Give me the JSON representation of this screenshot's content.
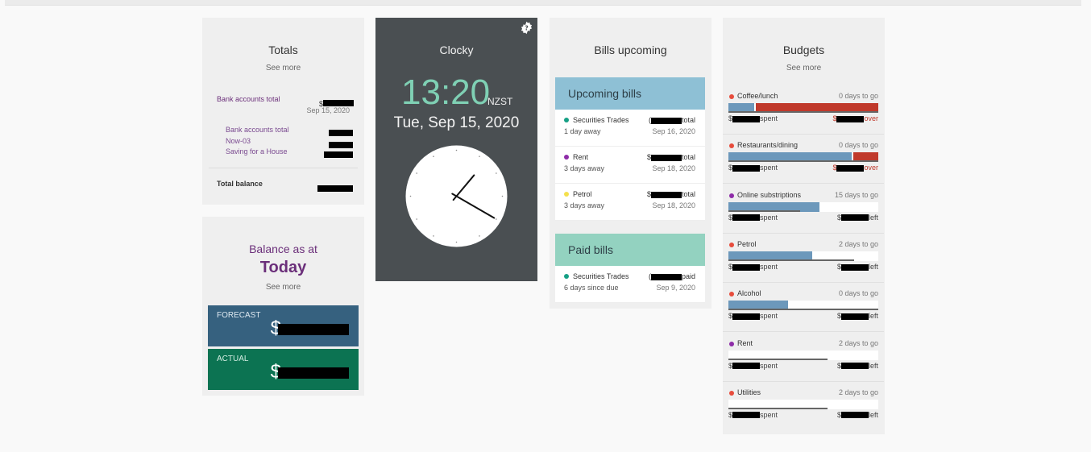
{
  "totals": {
    "title": "Totals",
    "see_more": "See more",
    "main_label": "Bank accounts total",
    "main_date": "Sep 15, 2020",
    "accounts": [
      {
        "label": "Bank accounts total"
      },
      {
        "label": "Now-03"
      },
      {
        "label": "Saving for a House"
      }
    ],
    "total_balance_label": "Total balance",
    "currency_prefix": "$"
  },
  "balance": {
    "label": "Balance as at",
    "period": "Today",
    "see_more": "See more",
    "forecast_label": "FORECAST",
    "actual_label": "ACTUAL",
    "currency_prefix": "$",
    "colors": {
      "forecast": "#36617f",
      "actual": "#0c7352"
    }
  },
  "clocky": {
    "title": "Clocky",
    "time": "13:20",
    "timezone": "NZST",
    "date": "Tue, Sep 15, 2020",
    "hour": 13,
    "minute": 20,
    "settings_icon": "gear-help-icon",
    "time_color": "#7fd0b4"
  },
  "bills": {
    "title": "Bills upcoming",
    "upcoming_heading": "Upcoming bills",
    "paid_heading": "Paid bills",
    "upcoming": [
      {
        "name": "Securities Trades",
        "due": "1 day away",
        "amount_prefix": "(",
        "amount_suffix": "total",
        "date": "Sep 16, 2020",
        "color": "#16a085"
      },
      {
        "name": "Rent",
        "due": "3 days away",
        "amount_prefix": "$",
        "amount_suffix": "total",
        "date": "Sep 18, 2020",
        "color": "#8e2ca8"
      },
      {
        "name": "Petrol",
        "due": "3 days away",
        "amount_prefix": "$",
        "amount_suffix": "total",
        "date": "Sep 18, 2020",
        "color": "#f4e04d"
      }
    ],
    "paid": [
      {
        "name": "Securities Trades",
        "due": "6 days since due",
        "amount_prefix": "(",
        "amount_suffix": "paid",
        "date": "Sep 9, 2020",
        "color": "#16a085"
      }
    ]
  },
  "budgets": {
    "title": "Budgets",
    "see_more": "See more",
    "items": [
      {
        "name": "Coffee/lunch",
        "days": "0 days to go",
        "spent_pct": 17,
        "over": true,
        "time_pct": 100,
        "spent_suffix": "spent",
        "left_suffix": "over",
        "color": "#e74c3c"
      },
      {
        "name": "Restaurants/dining",
        "days": "0 days to go",
        "spent_pct": 82,
        "over": true,
        "time_pct": 100,
        "spent_suffix": "spent",
        "left_suffix": "over",
        "color": "#e74c3c"
      },
      {
        "name": "Online substriptions",
        "days": "15 days to go",
        "spent_pct": 61,
        "over": false,
        "time_pct": 48,
        "spent_suffix": "spent",
        "left_suffix": "left",
        "color": "#8e2ca8"
      },
      {
        "name": "Petrol",
        "days": "2 days to go",
        "spent_pct": 56,
        "over": false,
        "time_pct": 84,
        "spent_suffix": "spent",
        "left_suffix": "left",
        "color": "#e74c3c"
      },
      {
        "name": "Alcohol",
        "days": "0 days to go",
        "spent_pct": 40,
        "over": false,
        "time_pct": 100,
        "spent_suffix": "spent",
        "left_suffix": "left",
        "color": "#e74c3c"
      },
      {
        "name": "Rent",
        "days": "2 days to go",
        "spent_pct": 0,
        "over": false,
        "time_pct": 66,
        "spent_suffix": "spent",
        "left_suffix": "left",
        "color": "#8e2ca8"
      },
      {
        "name": "Utilities",
        "days": "2 days to go",
        "spent_pct": 0,
        "over": false,
        "time_pct": 66,
        "spent_suffix": "spent",
        "left_suffix": "left",
        "color": "#e74c3c"
      }
    ]
  }
}
